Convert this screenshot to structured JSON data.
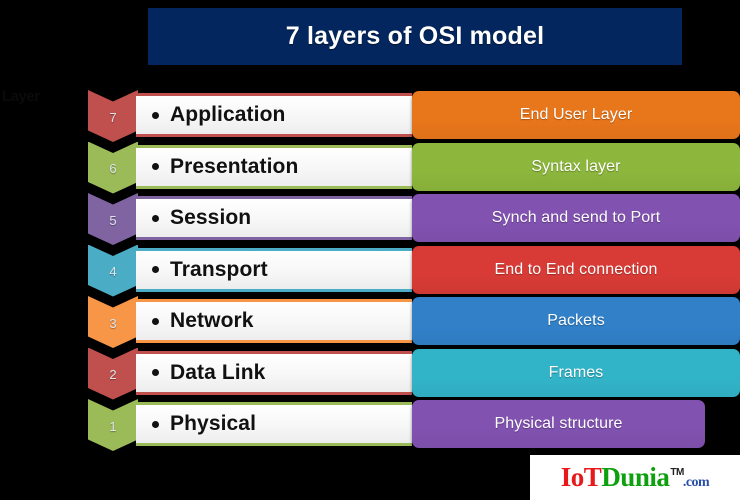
{
  "title": {
    "text": "7 layers of OSI model"
  },
  "side_caption": {
    "text": "Layer"
  },
  "layers": [
    {
      "number": "7",
      "name": "Application",
      "description": "End User Layer",
      "chevron_color": "#c0504d",
      "desc_color": "#e8761b"
    },
    {
      "number": "6",
      "name": "Presentation",
      "description": "Syntax layer",
      "chevron_color": "#9bbb59",
      "desc_color": "#8cb63c"
    },
    {
      "number": "5",
      "name": "Session",
      "description": "Synch and send to Port",
      "chevron_color": "#8064a2",
      "desc_color": "#8152b0"
    },
    {
      "number": "4",
      "name": "Transport",
      "description": "End to End connection",
      "chevron_color": "#4bacc6",
      "desc_color": "#d83b35"
    },
    {
      "number": "3",
      "name": "Network",
      "description": "Packets",
      "chevron_color": "#f79646",
      "desc_color": "#3180c8"
    },
    {
      "number": "2",
      "name": "Data Link",
      "description": "Frames",
      "chevron_color": "#c0504d",
      "desc_color": "#32b4c8"
    },
    {
      "number": "1",
      "name": "Physical",
      "description": "Physical structure",
      "chevron_color": "#9bbb59",
      "desc_color": "#8152b0"
    }
  ],
  "logo": {
    "part1": "IoT",
    "part2": "Dunia",
    "part3": ".com",
    "trademark": "TM"
  }
}
